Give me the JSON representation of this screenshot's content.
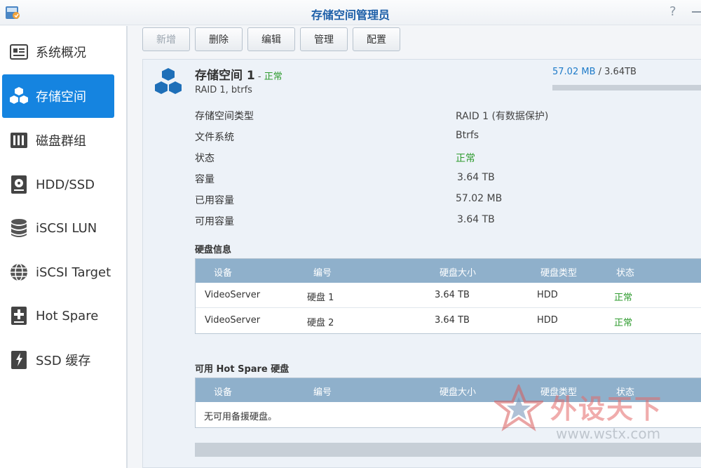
{
  "window": {
    "title": "存储空间管理员",
    "help": "?"
  },
  "sidebar": {
    "items": [
      {
        "label": "系统概况",
        "icon": "overview-icon",
        "active": false
      },
      {
        "label": "存储空间",
        "icon": "storage-cubes-icon",
        "active": true
      },
      {
        "label": "磁盘群组",
        "icon": "disk-group-icon",
        "active": false
      },
      {
        "label": "HDD/SSD",
        "icon": "hard-drive-icon",
        "active": false
      },
      {
        "label": "iSCSI LUN",
        "icon": "database-icon",
        "active": false
      },
      {
        "label": "iSCSI Target",
        "icon": "globe-icon",
        "active": false
      },
      {
        "label": "Hot Spare",
        "icon": "plus-drive-icon",
        "active": false
      },
      {
        "label": "SSD 缓存",
        "icon": "flash-drive-icon",
        "active": false
      }
    ]
  },
  "toolbar": {
    "create": "新增",
    "delete": "删除",
    "edit": "编辑",
    "manage": "管理",
    "configure": "配置"
  },
  "pool": {
    "name": "存储空间 1",
    "separator": " - ",
    "status": "正常",
    "subtitle": "RAID 1, btrfs",
    "used": "57.02 MB",
    "usage_sep": " /  ",
    "total": "3.64TB",
    "usage_fraction": 0.0
  },
  "properties": [
    {
      "label": "存储空间类型",
      "value": "RAID 1 (有数据保护)"
    },
    {
      "label": "文件系统",
      "value": "Btrfs"
    },
    {
      "label": "状态",
      "value": "正常"
    },
    {
      "label": "容量",
      "value": "3.64 TB"
    },
    {
      "label": "已用容量",
      "value": "57.02 MB"
    },
    {
      "label": "可用容量",
      "value": "3.64 TB"
    }
  ],
  "disk_info": {
    "title": "硬盘信息",
    "columns": [
      "设备",
      "编号",
      "硬盘大小",
      "硬盘类型",
      "状态"
    ],
    "rows": [
      {
        "device": "VideoServer",
        "number": "硬盘 1",
        "size": "3.64 TB",
        "type": "HDD",
        "status": "正常"
      },
      {
        "device": "VideoServer",
        "number": "硬盘 2",
        "size": "3.64 TB",
        "type": "HDD",
        "status": "正常"
      }
    ]
  },
  "hot_spare": {
    "title": "可用 Hot Spare 硬盘",
    "columns": [
      "设备",
      "编号",
      "硬盘大小",
      "硬盘类型",
      "状态"
    ],
    "empty": "无可用备援硬盘。"
  },
  "watermark": {
    "title": "外设天下",
    "url": "www.wstx.com"
  },
  "colors": {
    "accent": "#1584e0",
    "ok": "#2e9b2e",
    "header": "#8fb0cb"
  }
}
